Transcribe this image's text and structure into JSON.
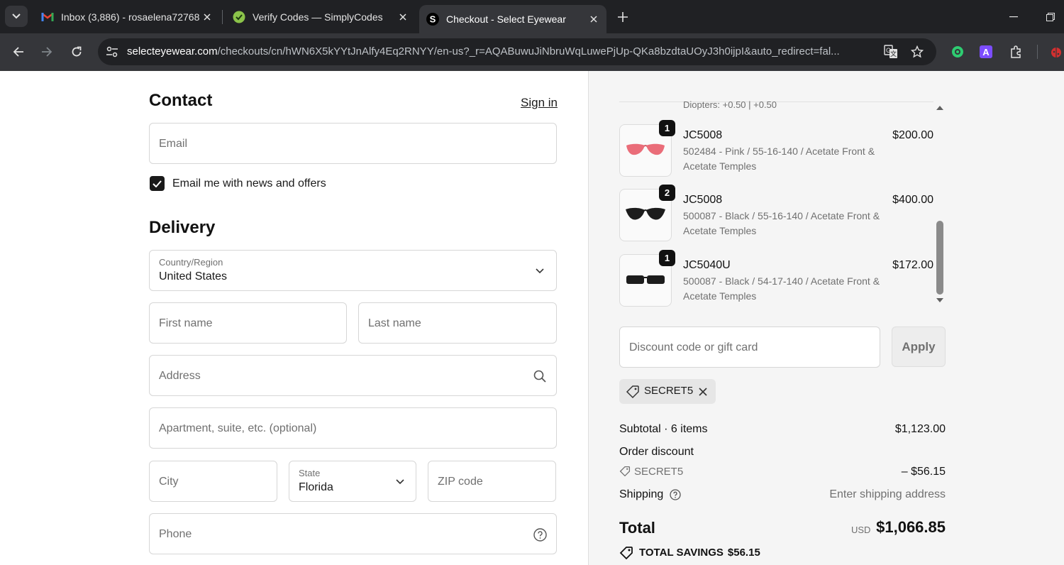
{
  "browser": {
    "tabs": [
      {
        "title": "Inbox (3,886) - rosaelena72768@",
        "favicon": "gmail-icon"
      },
      {
        "title": "Verify Codes — SimplyCodes",
        "favicon": "simplycodes-icon"
      },
      {
        "title": "Checkout - Select Eyewear",
        "favicon": "selecteyewear-icon",
        "active": true
      }
    ],
    "url_host": "selecteyewear.com",
    "url_path": "/checkouts/cn/hWN6X5kYYtJnAlfy4Eq2RNYY/en-us?_r=AQABuwuJiNbruWqLuwePjUp-QKa8bzdtaUOyJ3h0ijpI&auto_redirect=fal...",
    "extension_letter": "A"
  },
  "contact": {
    "title": "Contact",
    "signin_label": "Sign in",
    "email_placeholder": "Email",
    "newsletter_label": "Email me with news and offers",
    "newsletter_checked": true
  },
  "delivery": {
    "title": "Delivery",
    "country_label": "Country/Region",
    "country_value": "United States",
    "first_name_placeholder": "First name",
    "last_name_placeholder": "Last name",
    "address_placeholder": "Address",
    "apartment_placeholder": "Apartment, suite, etc. (optional)",
    "city_placeholder": "City",
    "state_label": "State",
    "state_value": "Florida",
    "zip_placeholder": "ZIP code",
    "phone_placeholder": "Phone"
  },
  "order": {
    "partial_line": "Diopters: +0.50 | +0.50",
    "items": [
      {
        "qty": "1",
        "name": "JC5008",
        "desc": "502484 - Pink / 55-16-140 / Acetate Front & Acetate Temples",
        "price": "$200.00",
        "color": "#e8707a"
      },
      {
        "qty": "2",
        "name": "JC5008",
        "desc": "500087 - Black / 55-16-140 / Acetate Front & Acetate Temples",
        "price": "$400.00",
        "color": "#1c1c1c"
      },
      {
        "qty": "1",
        "name": "JC5040U",
        "desc": "500087 - Black / 54-17-140 / Acetate Front & Acetate Temples",
        "price": "$172.00",
        "color": "#1c1c1c"
      }
    ],
    "discount_placeholder": "Discount code or gift card",
    "apply_label": "Apply",
    "applied_code": "SECRET5",
    "subtotal_label": "Subtotal · 6 items",
    "subtotal_value": "$1,123.00",
    "order_discount_label": "Order discount",
    "discount_code": "SECRET5",
    "discount_value": "– $56.15",
    "shipping_label": "Shipping",
    "shipping_value": "Enter shipping address",
    "total_label": "Total",
    "currency": "USD",
    "total_value": "$1,066.85",
    "savings_label": "TOTAL SAVINGS",
    "savings_value": "$56.15"
  }
}
